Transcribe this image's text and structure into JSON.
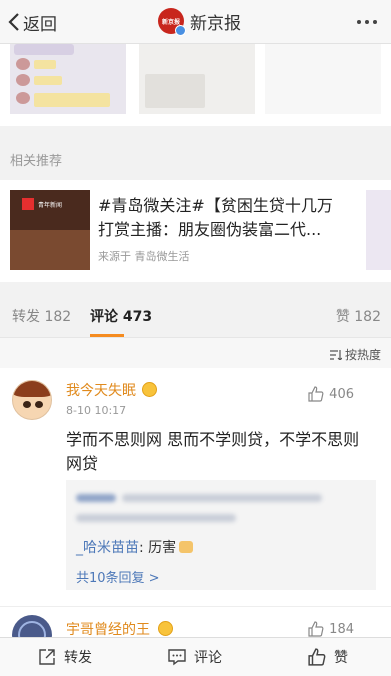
{
  "nav": {
    "back_label": "返回",
    "avatar_text": "新京报",
    "title": "新京报"
  },
  "related": {
    "label": "相关推荐",
    "thumb_text": "青年新闻",
    "title": "#青岛微关注#【贫困生贷十几万打赏主播：朋友圈伪装富二代...",
    "source": "来源于 青岛微生活"
  },
  "tabs": {
    "repost": "转发 182",
    "comments": "评论 473",
    "likes": "赞 182"
  },
  "sort_label": "按热度",
  "comments": [
    {
      "username": "我今天失眠",
      "time": "8-10 10:17",
      "likes": "406",
      "text": "学而不思则网 思而不学则贷，不学不思则网贷",
      "reply_user": "_哈米苗苗",
      "reply_text": ": 历害",
      "more_replies": "共10条回复 >"
    },
    {
      "username": "宇哥曾经的王",
      "likes": "184"
    }
  ],
  "bottom": {
    "repost": "转发",
    "comment": "评论",
    "like": "赞"
  },
  "colors": {
    "accent_orange": "#f58b1f",
    "username": "#e08a1d",
    "link_blue": "#4d78b8",
    "brand_red": "#c8261d"
  }
}
